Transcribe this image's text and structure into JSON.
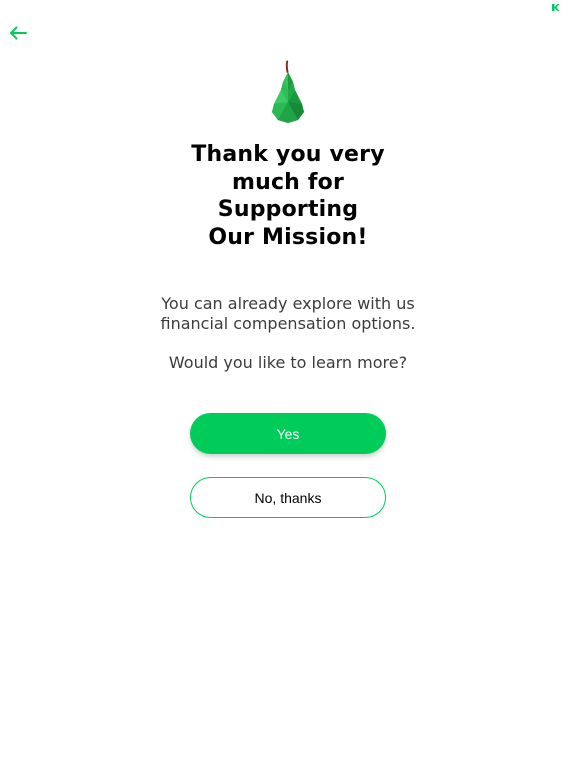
{
  "colors": {
    "accent": "#00cc5a",
    "title": "#000000",
    "body_text": "#3c3c3c",
    "background": "#ffffff"
  },
  "header": {
    "back_icon": "arrow-left-icon",
    "corner_icon": "app-badge-icon"
  },
  "hero": {
    "logo_icon": "pear-icon"
  },
  "title": {
    "lines": [
      "Thank you very",
      "much for",
      "Supporting",
      "Our Mission!"
    ]
  },
  "message": {
    "lines": [
      "You can already explore with us",
      "financial compensation options."
    ],
    "question": "Would you like to learn more?"
  },
  "actions": {
    "yes_label": "Yes",
    "no_label": "No, thanks"
  }
}
